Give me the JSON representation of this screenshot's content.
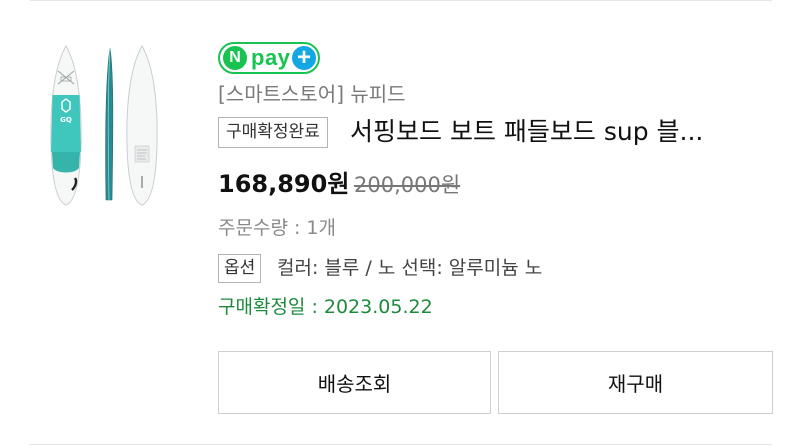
{
  "npay": {
    "n": "N",
    "label": "pay",
    "plus": "+"
  },
  "product": {
    "store": "[스마트스토어] 뉴피드",
    "status": "구매확정완료",
    "name": "서핑보드 보트 패들보드 sup 블...",
    "price": "168,890원",
    "original_price": "200,000원",
    "quantity": "주문수량 : 1개",
    "option_badge": "옵션",
    "option_text": "컬러: 블루 / 노 선택: 알루미늄 노",
    "confirm_date": "구매확정일 : 2023.05.22",
    "image_logo_text": "GQ"
  },
  "buttons": {
    "delivery": "배송조회",
    "rebuy": "재구매"
  },
  "colors": {
    "npay_green": "#19c352",
    "npay_blue": "#13a8e3",
    "teal": "#3fc7bd",
    "confirm_green": "#1f8a3e"
  },
  "icons": [
    "npay-logo-icon",
    "paddleboard-image"
  ]
}
